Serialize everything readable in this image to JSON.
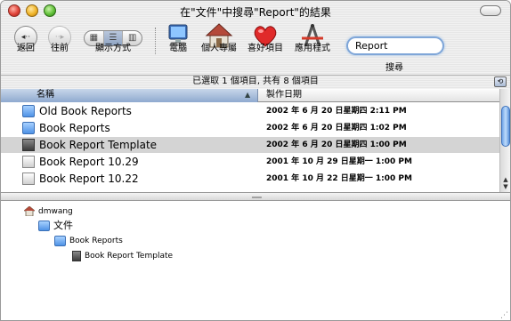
{
  "window": {
    "title": "在\"文件\"中搜尋\"Report\"的結果"
  },
  "toolbar": {
    "back_label": "返回",
    "forward_label": "往前",
    "view_label": "顯示方式",
    "view_modes": [
      "▦",
      "☰",
      "▥"
    ],
    "computer_label": "電腦",
    "home_label": "個人專屬",
    "favorites_label": "喜好項目",
    "applications_label": "應用程式",
    "search_label": "搜尋",
    "search_value": "Report"
  },
  "status": {
    "text": "已選取 1 個項目, 共有 8 個項目"
  },
  "columns": {
    "name": "名稱",
    "date": "製作日期"
  },
  "files": [
    {
      "name": "Old Book Reports",
      "date": "2002 年 6 月 20 日星期四 2:11 PM",
      "kind": "folder"
    },
    {
      "name": "Book Reports",
      "date": "2002 年 6 月 20 日星期四 1:02 PM",
      "kind": "folder"
    },
    {
      "name": "Book Report Template",
      "date": "2002 年 6 月 20 日星期四 1:00 PM",
      "kind": "template",
      "selected": true
    },
    {
      "name": "Book Report 10.29",
      "date": "2001 年 10 月 29 日星期一 1:00 PM",
      "kind": "document"
    },
    {
      "name": "Book Report 10.22",
      "date": "2001 年 10 月 22 日星期一 1:00 PM",
      "kind": "document"
    }
  ],
  "path": {
    "home": "dmwang",
    "documents": "文件",
    "folder": "Book Reports",
    "file": "Book Report Template"
  },
  "colors": {
    "accent": "#7fa6d8",
    "selection": "#d4d4d4",
    "header_active": "#8fa9cf"
  }
}
